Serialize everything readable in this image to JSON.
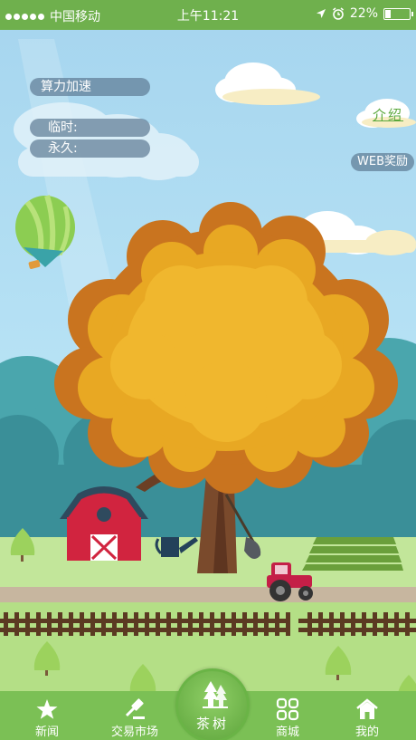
{
  "status_bar": {
    "carrier": "中国移动",
    "time": "上午11:21",
    "battery": "22%",
    "battery_level": 0.22
  },
  "overlay": {
    "boost_label": "算力加速",
    "temporary_label": "临时:",
    "permanent_label": "永久:",
    "intro_link": "介绍",
    "web_reward": "WEB奖励"
  },
  "tabs": {
    "news": "新闻",
    "market": "交易市场",
    "tea_tree": "茶树",
    "mall": "商城",
    "mine": "我的"
  },
  "colors": {
    "header_green": "#6fb04d",
    "tab_green": "#7bc055",
    "tree_orange": "#e8a823",
    "barn_red": "#d1243f"
  }
}
